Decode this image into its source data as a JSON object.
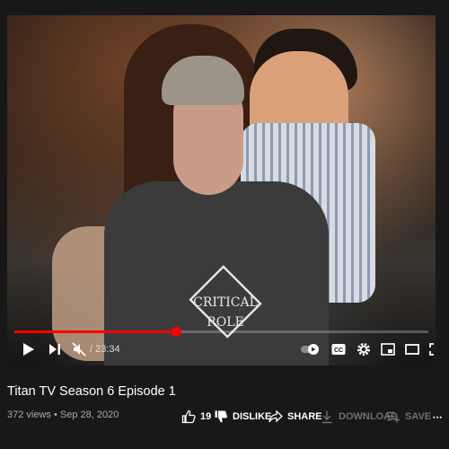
{
  "player": {
    "time_display": "/ 23:34",
    "progress": 0.39,
    "shirt_text": "CRITICAL ROLE"
  },
  "video": {
    "title": "Titan TV Season 6 Episode 1",
    "meta": "372 views • Sep 28, 2020"
  },
  "actions": {
    "like_count": "19",
    "dislike_label": "DISLIKE",
    "share_label": "SHARE",
    "download_label": "DOWNLOAD",
    "save_label": "SAVE"
  },
  "icons": {
    "play": "play-icon",
    "next": "next-icon",
    "mute": "mute-icon",
    "autoplay": "autoplay-toggle-icon",
    "captions": "cc-icon",
    "settings": "gear-icon",
    "miniplayer": "miniplayer-icon",
    "theater": "theater-icon",
    "fullscreen": "fullscreen-icon",
    "like": "thumbs-up-icon",
    "share": "share-icon",
    "download": "download-icon",
    "save": "playlist-add-icon",
    "more": "more-icon"
  },
  "colors": {
    "background": "#181818",
    "progress": "#ff0000",
    "muted_text": "#aaaaaa"
  }
}
